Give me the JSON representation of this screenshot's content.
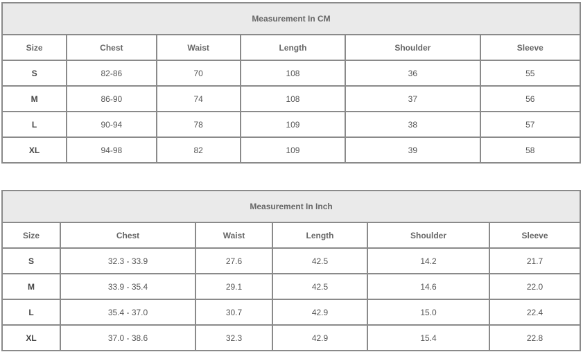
{
  "cm_table": {
    "title": "Measurement In CM",
    "headers": [
      "Size",
      "Chest",
      "Waist",
      "Length",
      "Shoulder",
      "Sleeve"
    ],
    "rows": [
      [
        "S",
        "82-86",
        "70",
        "108",
        "36",
        "55"
      ],
      [
        "M",
        "86-90",
        "74",
        "108",
        "37",
        "56"
      ],
      [
        "L",
        "90-94",
        "78",
        "109",
        "38",
        "57"
      ],
      [
        "XL",
        "94-98",
        "82",
        "109",
        "39",
        "58"
      ]
    ]
  },
  "inch_table": {
    "title": "Measurement In Inch",
    "headers": [
      "Size",
      "Chest",
      "Waist",
      "Length",
      "Shoulder",
      "Sleeve"
    ],
    "rows": [
      [
        "S",
        "32.3 - 33.9",
        "27.6",
        "42.5",
        "14.2",
        "21.7"
      ],
      [
        "M",
        "33.9 - 35.4",
        "29.1",
        "42.5",
        "14.6",
        "22.0"
      ],
      [
        "L",
        "35.4 - 37.0",
        "30.7",
        "42.9",
        "15.0",
        "22.4"
      ],
      [
        "XL",
        "37.0 - 38.6",
        "32.3",
        "42.9",
        "15.4",
        "22.8"
      ]
    ]
  },
  "colors": {
    "title_background": "#eaeaea",
    "border": "#8a8a8a",
    "text": "#555555"
  }
}
